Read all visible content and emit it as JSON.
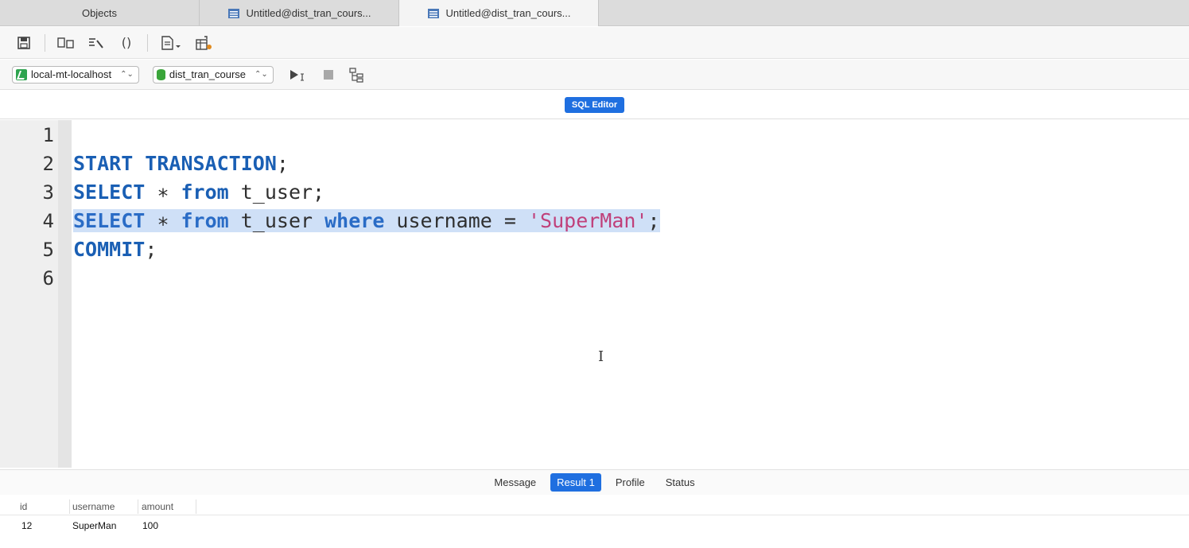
{
  "tabs": [
    {
      "label": "Objects",
      "active": false
    },
    {
      "label": "Untitled@dist_tran_cours...",
      "active": false
    },
    {
      "label": "Untitled@dist_tran_cours...",
      "active": true
    }
  ],
  "toolbar": {
    "icons": [
      "save-icon",
      "explain-icon",
      "beautify-icon",
      "parentheses-icon",
      "text-menu-icon",
      "snippet-icon"
    ],
    "parentheses_glyph": "()"
  },
  "connection": {
    "server": "local-mt-localhost",
    "database": "dist_tran_course",
    "run_icon": "run-icon",
    "stop_icon": "stop-icon",
    "explain_icon": "explain-plan-icon"
  },
  "editor_label": "SQL Editor",
  "editor": {
    "line_numbers": [
      "1",
      "2",
      "3",
      "4",
      "5",
      "6"
    ],
    "lines": [
      {
        "tokens": []
      },
      {
        "tokens": [
          {
            "t": "START TRANSACTION",
            "c": "kw"
          },
          {
            "t": ";",
            "c": ""
          }
        ]
      },
      {
        "tokens": [
          {
            "t": "SELECT",
            "c": "kw"
          },
          {
            "t": " ∗ ",
            "c": ""
          },
          {
            "t": "from",
            "c": "kw"
          },
          {
            "t": " t_user;",
            "c": ""
          }
        ]
      },
      {
        "selected": true,
        "tokens": [
          {
            "t": "SELECT",
            "c": "kw2"
          },
          {
            "t": " ∗ ",
            "c": ""
          },
          {
            "t": "from",
            "c": "kw2"
          },
          {
            "t": " t_user ",
            "c": ""
          },
          {
            "t": "where",
            "c": "kw2"
          },
          {
            "t": " username = ",
            "c": ""
          },
          {
            "t": "'SuperMan'",
            "c": "str"
          },
          {
            "t": ";",
            "c": ""
          }
        ]
      },
      {
        "tokens": [
          {
            "t": "COMMIT",
            "c": "kw"
          },
          {
            "t": ";",
            "c": ""
          }
        ]
      },
      {
        "tokens": []
      }
    ]
  },
  "result_tabs": [
    {
      "label": "Message",
      "active": false
    },
    {
      "label": "Result 1",
      "active": true
    },
    {
      "label": "Profile",
      "active": false
    },
    {
      "label": "Status",
      "active": false
    }
  ],
  "result_grid": {
    "columns": [
      "id",
      "username",
      "amount"
    ],
    "rows": [
      [
        "12",
        "SuperMan",
        "100"
      ]
    ]
  },
  "colors": {
    "accent": "#1f6fe0",
    "keyword": "#1a5fb4",
    "string": "#c0407a",
    "selection": "#cfe0f7"
  }
}
